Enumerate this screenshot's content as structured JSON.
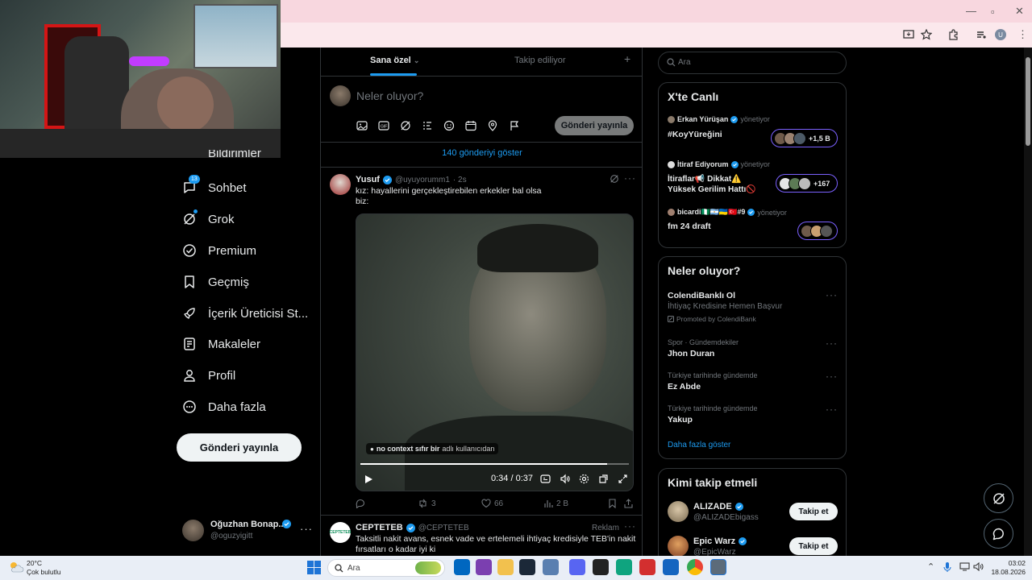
{
  "colors": {
    "accent": "#1d9bf0",
    "chrome_pink": "#f8d7df",
    "bg": "#000000",
    "border": "#2f3336",
    "muted": "#71767b"
  },
  "nav": {
    "partial_item": "Bildirimler",
    "items": [
      {
        "label": "Sohbet",
        "icon": "chat-icon",
        "badge": "13"
      },
      {
        "label": "Grok",
        "icon": "grok-icon"
      },
      {
        "label": "Premium",
        "icon": "premium-icon"
      },
      {
        "label": "Geçmiş",
        "icon": "bookmark-icon"
      },
      {
        "label": "İçerik Üreticisi St...",
        "icon": "rocket-icon"
      },
      {
        "label": "Makaleler",
        "icon": "article-icon"
      },
      {
        "label": "Profil",
        "icon": "person-icon"
      },
      {
        "label": "Daha fazla",
        "icon": "more-circle-icon"
      }
    ],
    "post_button": "Gönderi yayınla",
    "profile": {
      "name": "Oğuzhan Bonap...",
      "handle": "@oguzyigitt"
    }
  },
  "timeline": {
    "tabs": [
      "Sana özel",
      "Takip ediliyor"
    ],
    "compose_placeholder": "Neler oluyor?",
    "compose_button": "Gönderi yayınla",
    "show_new": "140 gönderiyi göster",
    "tweet1": {
      "name": "Yusuf",
      "handle": "@uyuyorumm1",
      "time": "· 2s",
      "line1": "kız: hayallerini gerçekleştirebilen erkekler bal olsa",
      "line2": "biz:",
      "caption_bold": "no context sıfır bir",
      "caption_rest": "adlı kullanıcıdan",
      "video_time": "0:34 / 0:37",
      "retweets": "3",
      "likes": "66",
      "views": "2 B",
      "progress": 0.92
    },
    "tweet2": {
      "name": "CEPTETEB",
      "handle": "@CEPTETEB",
      "ad_label": "Reklam",
      "line1": "Taksitli nakit avans, esnek vade ve ertelemeli ihtiyaç kredisiyle TEB'in nakit",
      "line2": "fırsatları o kadar iyi ki",
      "logo_text": "CEPTETEB"
    }
  },
  "sidebar": {
    "search_placeholder": "Ara",
    "live_title": "X'te Canlı",
    "live": [
      {
        "host": "Erkan Yürüşan",
        "role": "yönetiyor",
        "title": "#KoyYüreğini",
        "count": "+1,5 B"
      },
      {
        "host": "İtiraf Ediyorum",
        "role": "yönetiyor",
        "title1": "İtiraflar📢 Dikkat⚠️",
        "title2": "Yüksek Gerilim Hattı🚫",
        "count": "+167"
      },
      {
        "host": "bicardi🇳🇬🇦🇷🇺🇦🇹🇷#9",
        "role": "yönetiyor",
        "title": "fm 24 draft"
      }
    ],
    "trends_title": "Neler oluyor?",
    "trends": [
      {
        "name": "ColendiBanklı Ol",
        "sub": "İhtiyaç Kredisine Hemen Başvur",
        "promo": "Promoted by ColendiBank"
      },
      {
        "cat": "Spor · Gündemdekiler",
        "name": "Jhon Duran"
      },
      {
        "cat": "Türkiye tarihinde gündemde",
        "name": "Ez Abde"
      },
      {
        "cat": "Türkiye tarihinde gündemde",
        "name": "Yakup"
      }
    ],
    "show_more": "Daha fazla göster",
    "who_title": "Kimi takip etmeli",
    "who": [
      {
        "name": "ALIZADE",
        "handle": "@ALIZADEbigass",
        "button": "Takip et"
      },
      {
        "name": "Epic Warz",
        "handle": "@EpicWarz",
        "button": "Takip et"
      }
    ]
  },
  "taskbar": {
    "weather_temp": "20°C",
    "weather_desc": "Çok bulutlu",
    "search": "Ara",
    "time": "03:02",
    "date": "18.08.2026"
  },
  "browser": {
    "profile_initial": "U"
  }
}
